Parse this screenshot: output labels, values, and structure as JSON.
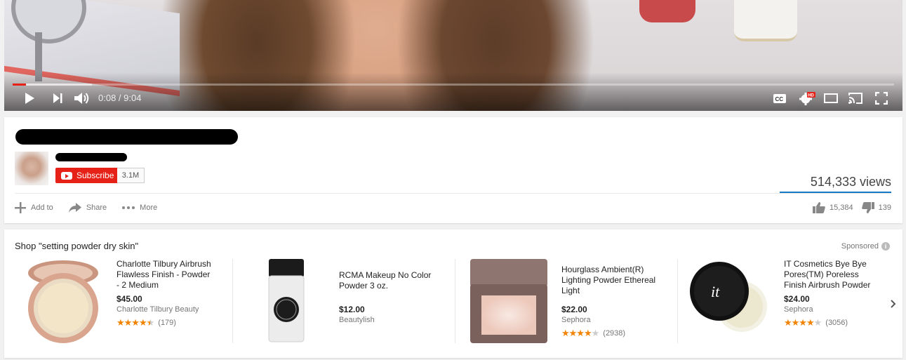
{
  "player": {
    "current_time": "0:08",
    "separator": " / ",
    "duration": "9:04",
    "progress_fraction": 0.015,
    "buffered_fraction": 0.09,
    "hd_badge": "HD"
  },
  "channel": {
    "subscribe_label": "Subscribe",
    "subscriber_count": "3.1M"
  },
  "stats": {
    "views": "514,333 views",
    "likes": "15,384",
    "dislikes": "139"
  },
  "actions": {
    "add_to": "Add to",
    "share": "Share",
    "more": "More"
  },
  "shopping": {
    "title": "Shop \"setting powder dry skin\"",
    "sponsored": "Sponsored",
    "products": [
      {
        "title": "Charlotte Tilbury Airbrush Flawless Finish - Powder - 2 Medium",
        "price": "$45.00",
        "seller": "Charlotte Tilbury Beauty",
        "rating": 4.5,
        "reviews": "(179)"
      },
      {
        "title": "RCMA Makeup No Color Powder 3 oz.",
        "price": "$12.00",
        "seller": "Beautylish",
        "rating": null,
        "reviews": ""
      },
      {
        "title": "Hourglass Ambient(R) Lighting Powder Ethereal Light",
        "price": "$22.00",
        "seller": "Sephora",
        "rating": 4,
        "reviews": "(2938)"
      },
      {
        "title": "IT Cosmetics Bye Bye Pores(TM) Poreless Finish Airbrush Powder",
        "price": "$24.00",
        "seller": "Sephora",
        "rating": 4,
        "reviews": "(3056)"
      }
    ]
  },
  "colors": {
    "accent_red": "#e62117",
    "link_blue": "#167ac6",
    "star_orange": "#f28300"
  }
}
